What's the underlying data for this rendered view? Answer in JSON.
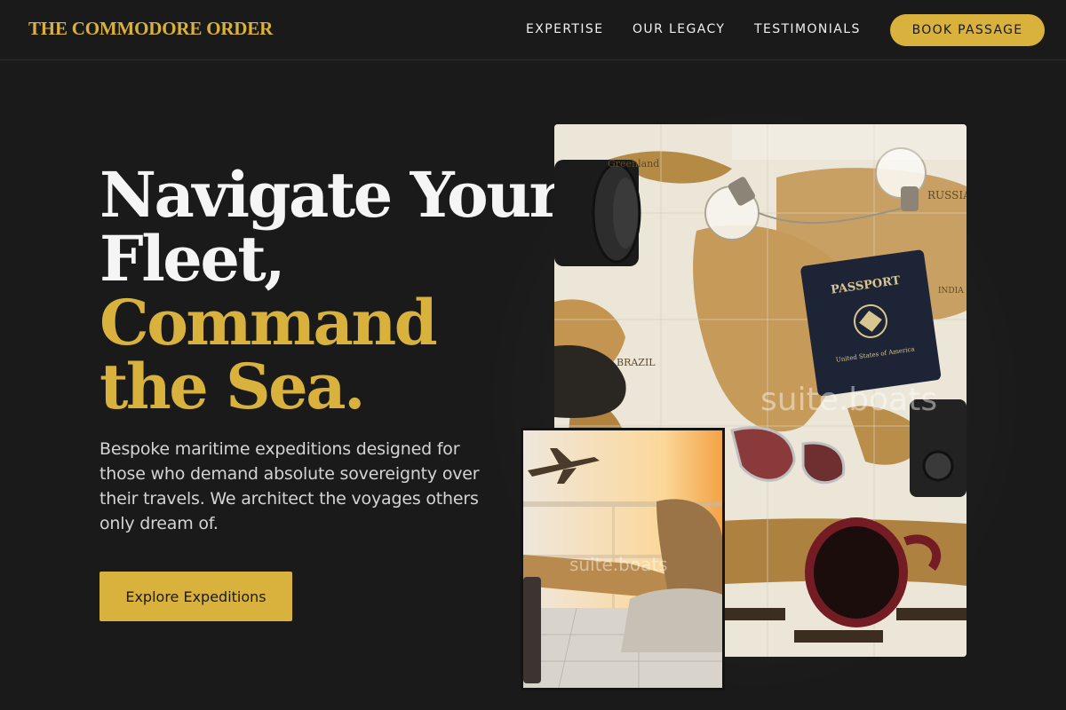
{
  "brand": {
    "name": "THE COMMODORE ORDER",
    "color": "#d8b23c"
  },
  "nav": {
    "items": [
      {
        "label": "EXPERTISE"
      },
      {
        "label": "OUR LEGACY"
      },
      {
        "label": "TESTIMONIALS"
      }
    ],
    "cta_label": "BOOK PASSAGE"
  },
  "hero": {
    "headline_lines": [
      "Navigate Your",
      "Fleet,",
      "Command",
      "the Sea."
    ],
    "description": "Bespoke maritime expeditions designed for those who demand absolute sovereignty over their travels. We architect the voyages others only dream of.",
    "cta_label": "Explore Expeditions"
  },
  "images": {
    "main": {
      "watermark": "suite.boats",
      "passport_text": "PASSPORT",
      "passport_sub": "United States of America",
      "map_labels": [
        "Greenland",
        "RUSSIA",
        "INDIA",
        "BRAZIL"
      ]
    },
    "secondary": {
      "watermark": "suite.boats"
    }
  },
  "colors": {
    "background": "#1a1a1a",
    "accent": "#d8b23c",
    "text": "#f2f2f2",
    "muted": "#d4d4d4"
  }
}
